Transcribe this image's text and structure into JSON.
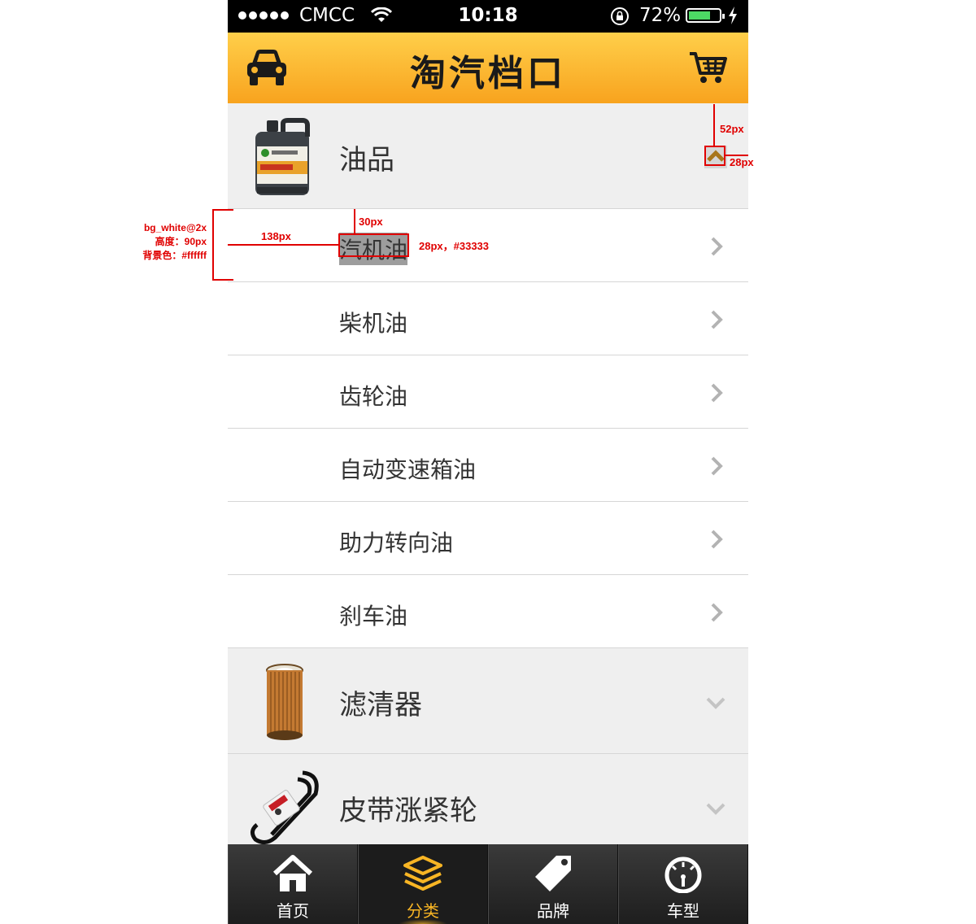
{
  "status_bar": {
    "carrier": "CMCC",
    "time": "10:18",
    "battery_percent": "72%",
    "battery_level": 0.72
  },
  "navbar": {
    "title": "淘汽档口",
    "left_icon": "car-icon",
    "right_icon": "cart-icon"
  },
  "categories": [
    {
      "label": "油品",
      "icon": "motor-oil-jug-icon",
      "expanded": true,
      "items": [
        "汽机油",
        "柴机油",
        "齿轮油",
        "自动变速箱油",
        "助力转向油",
        "刹车油"
      ]
    },
    {
      "label": "滤清器",
      "icon": "oil-filter-icon",
      "expanded": false
    },
    {
      "label": "皮带涨紧轮",
      "icon": "belt-icon",
      "expanded": false
    }
  ],
  "tabbar": {
    "tabs": [
      {
        "label": "首页",
        "icon": "home-icon",
        "active": false
      },
      {
        "label": "分类",
        "icon": "layers-icon",
        "active": true
      },
      {
        "label": "品牌",
        "icon": "tag-icon",
        "active": false
      },
      {
        "label": "车型",
        "icon": "speedometer-icon",
        "active": false
      }
    ]
  },
  "annotations": {
    "row_spec_line1": "bg_white@2x",
    "row_spec_line2": "高度：90px",
    "row_spec_line3": "背景色：#ffffff",
    "left_indent": "138px",
    "top_margin": "30px",
    "text_spec": "28px，#33333",
    "toggle_right": "52px",
    "toggle_size": "28px"
  },
  "colors": {
    "accent": "#f8b524",
    "nav_top": "#ffcf4a",
    "nav_bottom": "#f8a31e",
    "text": "#333333",
    "annotation": "#e00000",
    "category_bg": "#efefef",
    "row_bg": "#ffffff"
  }
}
